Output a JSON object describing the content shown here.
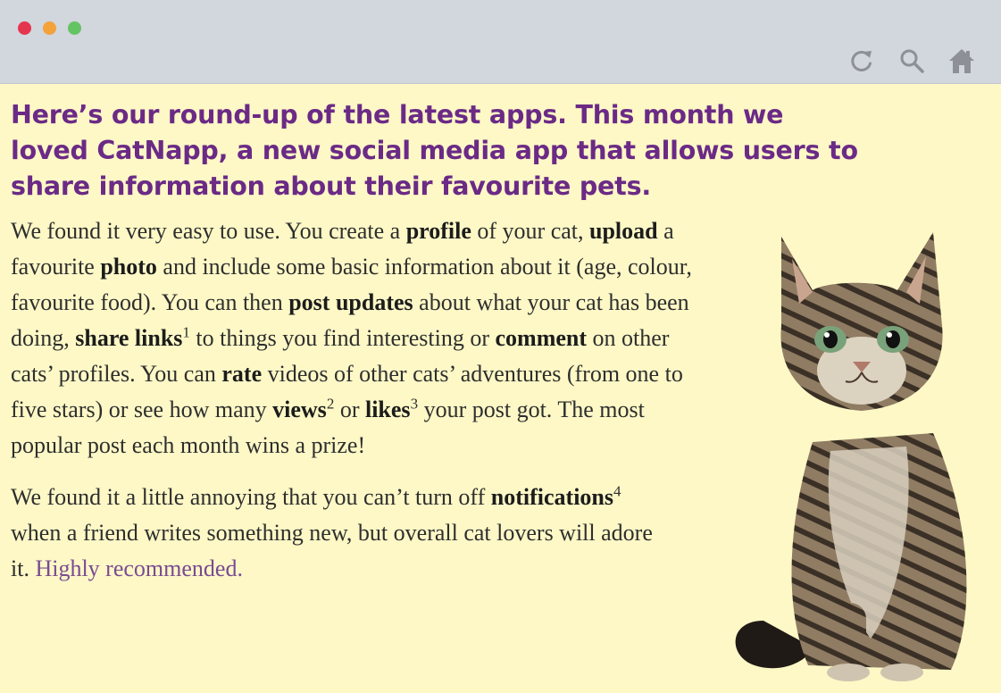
{
  "browser": {
    "traffic_lights": [
      "#e5364f",
      "#f4a23a",
      "#64c363"
    ],
    "nav_icons": [
      "refresh-icon",
      "search-icon",
      "home-icon"
    ],
    "icon_color": "#8d9097",
    "toolbar_color": "#d2d6dd"
  },
  "article": {
    "headline": "Here’s our round-up of the latest apps. This month we loved CatNapp, a new social media app that allows users to share information about their favourite pets.",
    "p1": {
      "t1": "We found it very easy to use. You create a ",
      "b1": "profile",
      "t2": " of your cat, ",
      "b2": "upload",
      "t3": " a favourite ",
      "b3": "photo",
      "t4": " and include some basic information about it (age, colour, favourite food). You can then ",
      "b4": "post updates",
      "t5": " about what your cat has been doing, ",
      "b5": "share links",
      "s1": "1",
      "t6": " to things you find interesting or ",
      "b6": "comment",
      "t7": " on other cats’ profiles. You can ",
      "b7": "rate",
      "t8": " videos of other cats’ adventures (from one to five stars) or see how many ",
      "b8": "views",
      "s2": "2",
      "t9": " or ",
      "b9": "likes",
      "s3": "3",
      "t10": " your post got. The most popular post each month wins a prize!"
    },
    "p2": {
      "t1": "We found it a little annoying that you can’t turn off ",
      "b1": "notifications",
      "s1": "4",
      "t2": " when a friend writes something new, but overall cat lovers will adore it. ",
      "highlight": "Highly recommended."
    },
    "colors": {
      "headline": "#6b2a86",
      "highlight": "#7a4a94",
      "background": "#fdf8c6"
    }
  },
  "image": {
    "subject": "kitten"
  }
}
